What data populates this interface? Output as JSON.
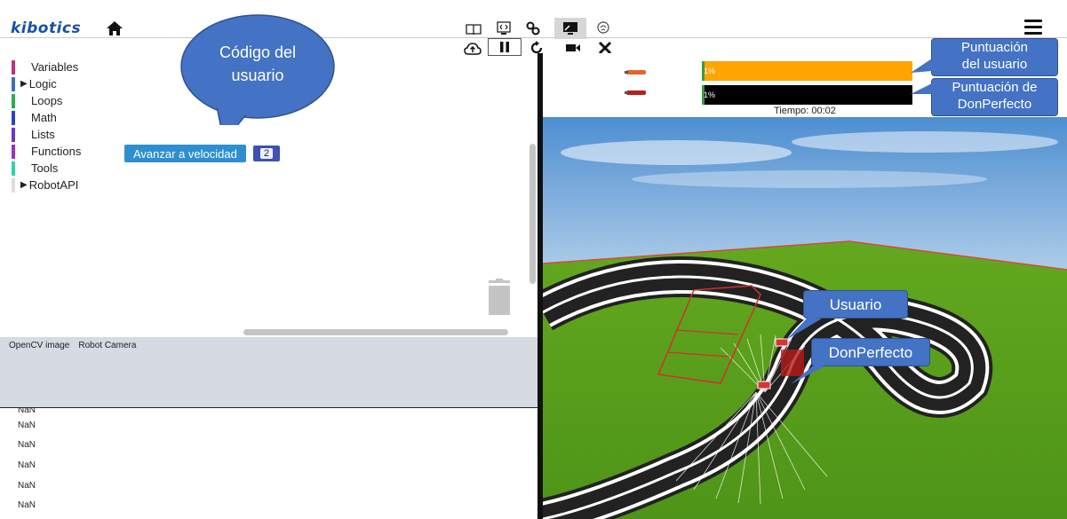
{
  "app": {
    "logo": "kibotics"
  },
  "toolbar": {
    "icons": [
      "book-icon",
      "code-icon",
      "gears-icon",
      "screen-icon",
      "brain-icon",
      "cloud-upload-icon",
      "pause-icon",
      "reload-icon",
      "camera-icon",
      "close-icon"
    ]
  },
  "blockly": {
    "categories": [
      {
        "label": "Variables",
        "color": "#c2307a",
        "expandable": false
      },
      {
        "label": "Logic",
        "color": "#3b6fc0",
        "expandable": true
      },
      {
        "label": "Loops",
        "color": "#2eae4a",
        "expandable": false
      },
      {
        "label": "Math",
        "color": "#2a46b8",
        "expandable": false
      },
      {
        "label": "Lists",
        "color": "#6b3bbd",
        "expandable": false
      },
      {
        "label": "Functions",
        "color": "#9b35b8",
        "expandable": false
      },
      {
        "label": "Tools",
        "color": "#2dd4a7",
        "expandable": false
      },
      {
        "label": "RobotAPI",
        "color": "#dddddd",
        "expandable": true
      }
    ],
    "block": {
      "label": "Avanzar a velocidad",
      "value": "2"
    },
    "callout": {
      "line1": "Código del",
      "line2": "usuario"
    }
  },
  "camera_panel": {
    "tabs": [
      "OpenCV image",
      "Robot Camera"
    ]
  },
  "console": {
    "rows": [
      "NaN",
      "NaN",
      "NaN",
      "NaN",
      "NaN",
      "NaN"
    ]
  },
  "scores": {
    "user": {
      "percent": "1%",
      "fill": 0.01,
      "color": "#ffa500"
    },
    "bot": {
      "percent": "1%",
      "fill": 0.01,
      "color": "#000000"
    },
    "timer": "Tiempo: 00:02"
  },
  "notes": {
    "user_score": {
      "line1": "Puntuación",
      "line2": "del usuario"
    },
    "bot_score": {
      "line1": "Puntuación de",
      "line2": "DonPerfecto"
    },
    "user_car": "Usuario",
    "bot_car": "DonPerfecto"
  }
}
